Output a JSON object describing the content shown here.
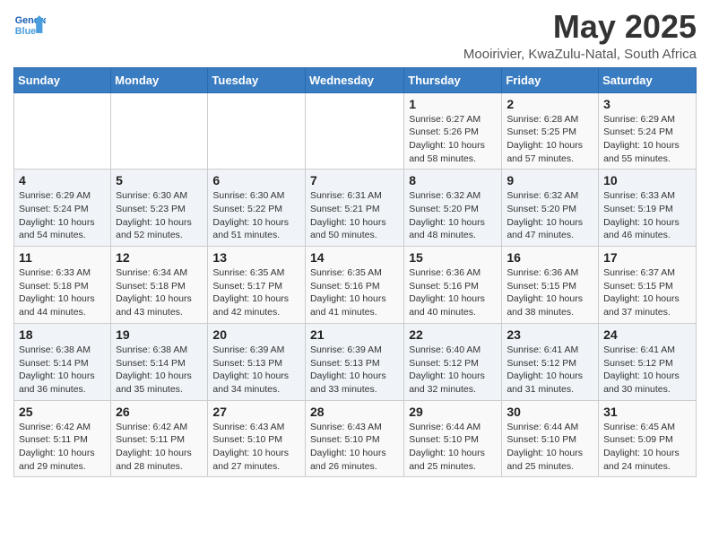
{
  "header": {
    "logo_text_general": "General",
    "logo_text_blue": "Blue",
    "month_title": "May 2025",
    "location": "Mooirivier, KwaZulu-Natal, South Africa"
  },
  "days_of_week": [
    "Sunday",
    "Monday",
    "Tuesday",
    "Wednesday",
    "Thursday",
    "Friday",
    "Saturday"
  ],
  "weeks": [
    [
      {
        "day": "",
        "info": ""
      },
      {
        "day": "",
        "info": ""
      },
      {
        "day": "",
        "info": ""
      },
      {
        "day": "",
        "info": ""
      },
      {
        "day": "1",
        "info": "Sunrise: 6:27 AM\nSunset: 5:26 PM\nDaylight: 10 hours and 58 minutes."
      },
      {
        "day": "2",
        "info": "Sunrise: 6:28 AM\nSunset: 5:25 PM\nDaylight: 10 hours and 57 minutes."
      },
      {
        "day": "3",
        "info": "Sunrise: 6:29 AM\nSunset: 5:24 PM\nDaylight: 10 hours and 55 minutes."
      }
    ],
    [
      {
        "day": "4",
        "info": "Sunrise: 6:29 AM\nSunset: 5:24 PM\nDaylight: 10 hours and 54 minutes."
      },
      {
        "day": "5",
        "info": "Sunrise: 6:30 AM\nSunset: 5:23 PM\nDaylight: 10 hours and 52 minutes."
      },
      {
        "day": "6",
        "info": "Sunrise: 6:30 AM\nSunset: 5:22 PM\nDaylight: 10 hours and 51 minutes."
      },
      {
        "day": "7",
        "info": "Sunrise: 6:31 AM\nSunset: 5:21 PM\nDaylight: 10 hours and 50 minutes."
      },
      {
        "day": "8",
        "info": "Sunrise: 6:32 AM\nSunset: 5:20 PM\nDaylight: 10 hours and 48 minutes."
      },
      {
        "day": "9",
        "info": "Sunrise: 6:32 AM\nSunset: 5:20 PM\nDaylight: 10 hours and 47 minutes."
      },
      {
        "day": "10",
        "info": "Sunrise: 6:33 AM\nSunset: 5:19 PM\nDaylight: 10 hours and 46 minutes."
      }
    ],
    [
      {
        "day": "11",
        "info": "Sunrise: 6:33 AM\nSunset: 5:18 PM\nDaylight: 10 hours and 44 minutes."
      },
      {
        "day": "12",
        "info": "Sunrise: 6:34 AM\nSunset: 5:18 PM\nDaylight: 10 hours and 43 minutes."
      },
      {
        "day": "13",
        "info": "Sunrise: 6:35 AM\nSunset: 5:17 PM\nDaylight: 10 hours and 42 minutes."
      },
      {
        "day": "14",
        "info": "Sunrise: 6:35 AM\nSunset: 5:16 PM\nDaylight: 10 hours and 41 minutes."
      },
      {
        "day": "15",
        "info": "Sunrise: 6:36 AM\nSunset: 5:16 PM\nDaylight: 10 hours and 40 minutes."
      },
      {
        "day": "16",
        "info": "Sunrise: 6:36 AM\nSunset: 5:15 PM\nDaylight: 10 hours and 38 minutes."
      },
      {
        "day": "17",
        "info": "Sunrise: 6:37 AM\nSunset: 5:15 PM\nDaylight: 10 hours and 37 minutes."
      }
    ],
    [
      {
        "day": "18",
        "info": "Sunrise: 6:38 AM\nSunset: 5:14 PM\nDaylight: 10 hours and 36 minutes."
      },
      {
        "day": "19",
        "info": "Sunrise: 6:38 AM\nSunset: 5:14 PM\nDaylight: 10 hours and 35 minutes."
      },
      {
        "day": "20",
        "info": "Sunrise: 6:39 AM\nSunset: 5:13 PM\nDaylight: 10 hours and 34 minutes."
      },
      {
        "day": "21",
        "info": "Sunrise: 6:39 AM\nSunset: 5:13 PM\nDaylight: 10 hours and 33 minutes."
      },
      {
        "day": "22",
        "info": "Sunrise: 6:40 AM\nSunset: 5:12 PM\nDaylight: 10 hours and 32 minutes."
      },
      {
        "day": "23",
        "info": "Sunrise: 6:41 AM\nSunset: 5:12 PM\nDaylight: 10 hours and 31 minutes."
      },
      {
        "day": "24",
        "info": "Sunrise: 6:41 AM\nSunset: 5:12 PM\nDaylight: 10 hours and 30 minutes."
      }
    ],
    [
      {
        "day": "25",
        "info": "Sunrise: 6:42 AM\nSunset: 5:11 PM\nDaylight: 10 hours and 29 minutes."
      },
      {
        "day": "26",
        "info": "Sunrise: 6:42 AM\nSunset: 5:11 PM\nDaylight: 10 hours and 28 minutes."
      },
      {
        "day": "27",
        "info": "Sunrise: 6:43 AM\nSunset: 5:10 PM\nDaylight: 10 hours and 27 minutes."
      },
      {
        "day": "28",
        "info": "Sunrise: 6:43 AM\nSunset: 5:10 PM\nDaylight: 10 hours and 26 minutes."
      },
      {
        "day": "29",
        "info": "Sunrise: 6:44 AM\nSunset: 5:10 PM\nDaylight: 10 hours and 25 minutes."
      },
      {
        "day": "30",
        "info": "Sunrise: 6:44 AM\nSunset: 5:10 PM\nDaylight: 10 hours and 25 minutes."
      },
      {
        "day": "31",
        "info": "Sunrise: 6:45 AM\nSunset: 5:09 PM\nDaylight: 10 hours and 24 minutes."
      }
    ]
  ]
}
